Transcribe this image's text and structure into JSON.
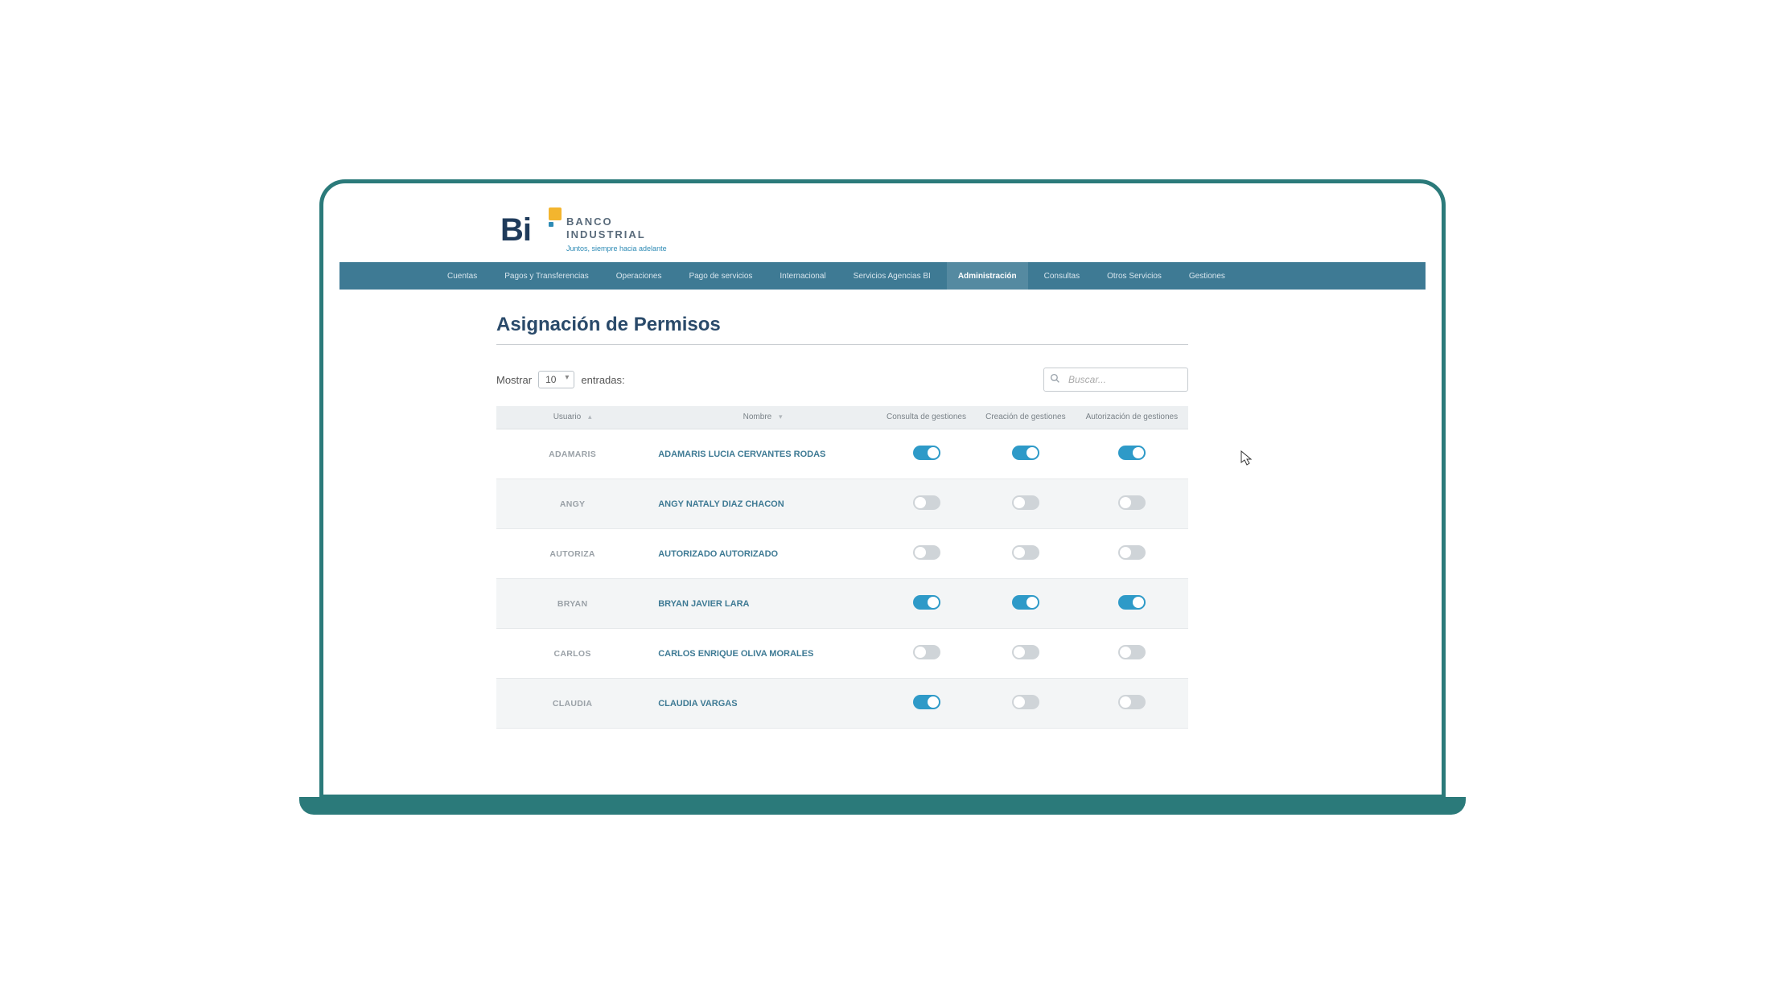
{
  "brand": {
    "name_line1": "BANCO",
    "name_line2": "INDUSTRIAL",
    "slogan": "Juntos, siempre hacia adelante"
  },
  "nav": {
    "items": [
      {
        "label": "Cuentas",
        "active": false
      },
      {
        "label": "Pagos y Transferencias",
        "active": false
      },
      {
        "label": "Operaciones",
        "active": false
      },
      {
        "label": "Pago de servicios",
        "active": false
      },
      {
        "label": "Internacional",
        "active": false
      },
      {
        "label": "Servicios Agencias BI",
        "active": false
      },
      {
        "label": "Administración",
        "active": true
      },
      {
        "label": "Consultas",
        "active": false
      },
      {
        "label": "Otros Servicios",
        "active": false
      },
      {
        "label": "Gestiones",
        "active": false
      }
    ]
  },
  "page": {
    "title": "Asignación de Permisos",
    "show_label": "Mostrar",
    "entries_count": "10",
    "entries_label": "entradas:",
    "search_placeholder": "Buscar..."
  },
  "table": {
    "headers": {
      "user": "Usuario",
      "name": "Nombre",
      "consulta": "Consulta de gestiones",
      "creacion": "Creación de gestiones",
      "autorizacion": "Autorización de gestiones"
    },
    "rows": [
      {
        "user": "ADAMARIS",
        "name": "ADAMARIS LUCIA CERVANTES RODAS",
        "consulta": true,
        "creacion": true,
        "autorizacion": true
      },
      {
        "user": "ANGY",
        "name": "ANGY NATALY DIAZ CHACON",
        "consulta": false,
        "creacion": false,
        "autorizacion": false
      },
      {
        "user": "AUTORIZA",
        "name": "AUTORIZADO AUTORIZADO",
        "consulta": false,
        "creacion": false,
        "autorizacion": false
      },
      {
        "user": "BRYAN",
        "name": "BRYAN JAVIER LARA",
        "consulta": true,
        "creacion": true,
        "autorizacion": true
      },
      {
        "user": "CARLOS",
        "name": "CARLOS ENRIQUE OLIVA MORALES",
        "consulta": false,
        "creacion": false,
        "autorizacion": false
      },
      {
        "user": "CLAUDIA",
        "name": "CLAUDIA VARGAS",
        "consulta": true,
        "creacion": false,
        "autorizacion": false
      }
    ]
  },
  "colors": {
    "navbar": "#3e7a94",
    "title": "#2a4a6a",
    "toggle_on": "#2e9ac8",
    "toggle_off": "#cfd4d8",
    "frame": "#2b7a7a",
    "accent_yellow": "#f3b52e"
  }
}
